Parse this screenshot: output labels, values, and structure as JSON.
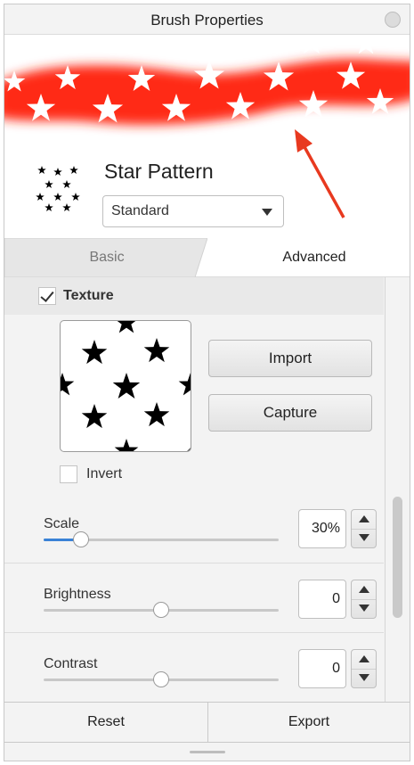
{
  "window": {
    "title": "Brush Properties"
  },
  "brush": {
    "name": "Star Pattern",
    "mode": "Standard"
  },
  "tabs": [
    {
      "label": "Basic",
      "active": false
    },
    {
      "label": "Advanced",
      "active": true
    }
  ],
  "texture": {
    "label": "Texture",
    "checked": true,
    "import_label": "Import",
    "capture_label": "Capture",
    "invert_label": "Invert",
    "invert_checked": false
  },
  "sliders": [
    {
      "label": "Scale",
      "value": "30%",
      "level": 0.16
    },
    {
      "label": "Brightness",
      "value": "0",
      "level": 0.5
    },
    {
      "label": "Contrast",
      "value": "0",
      "level": 0.5
    }
  ],
  "footer": {
    "reset_label": "Reset",
    "export_label": "Export"
  },
  "colors": {
    "stroke": "#ff2a14",
    "accent": "#3a82d6",
    "arrow": "#e8391f"
  },
  "icons": [
    "close-icon",
    "chevron-down-icon",
    "checkmark-icon",
    "arrow-up-icon",
    "arrow-down-icon",
    "resize-grip-icon"
  ]
}
